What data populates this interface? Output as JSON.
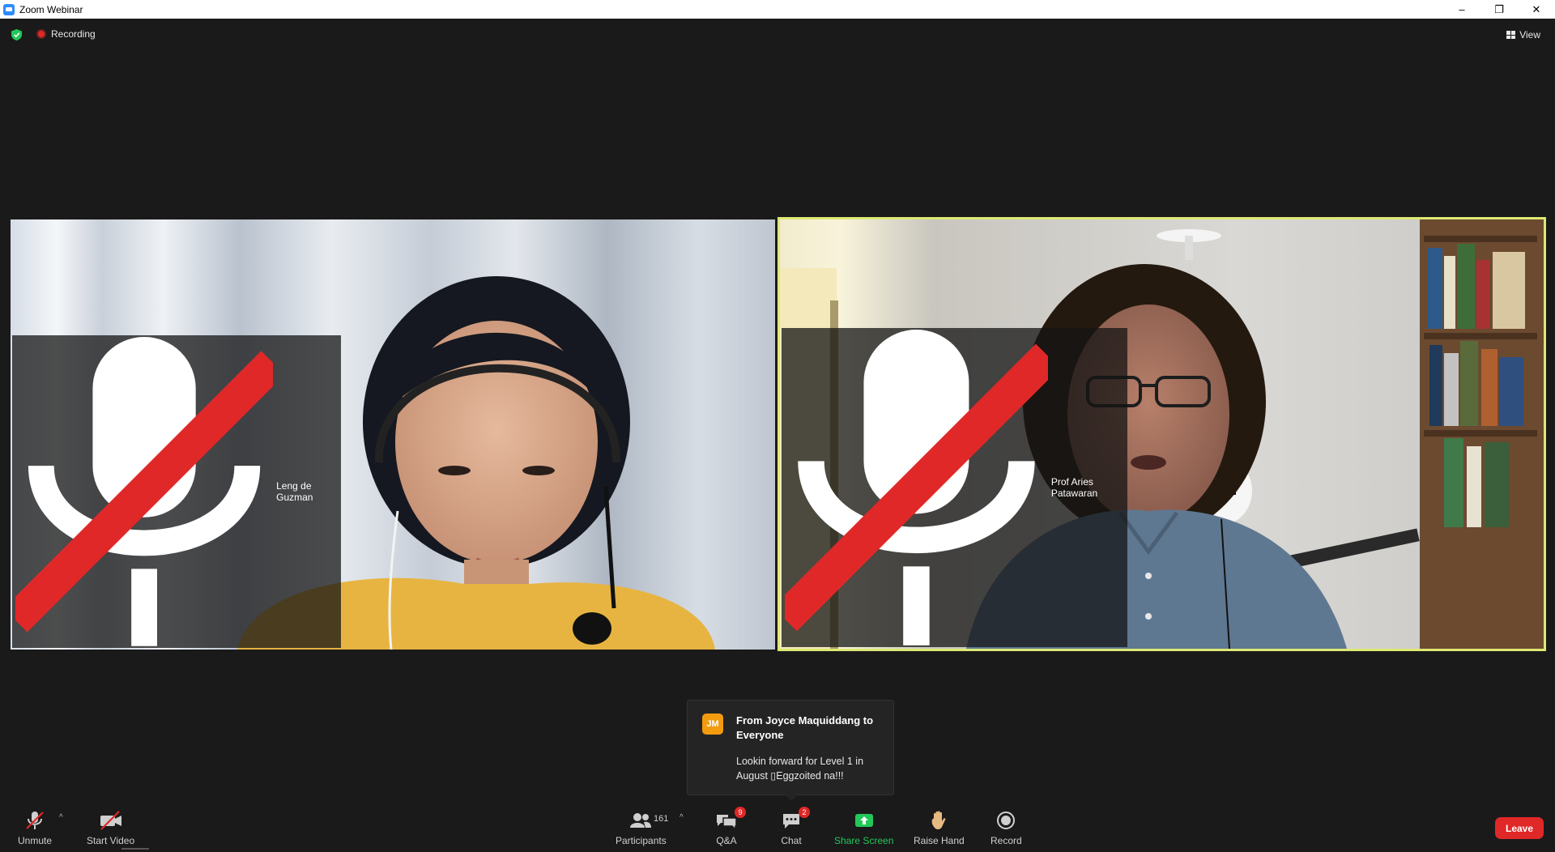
{
  "window": {
    "title": "Zoom Webinar",
    "controls": [
      "–",
      "❐",
      "✕"
    ]
  },
  "status": {
    "recording_label": "Recording",
    "view_label": "View"
  },
  "colors": {
    "active_speaker_border": "#dde874",
    "leave": "#e02828",
    "share_green": "#22c85a",
    "avatar_orange": "#f29b0e"
  },
  "participants": [
    {
      "name": "Leng de Guzman",
      "muted": true
    },
    {
      "name": "Prof Aries Patawaran",
      "muted": true,
      "active_speaker": true
    }
  ],
  "chat_notification": {
    "avatar_initials": "JM",
    "from": "From Joyce Maquiddang to Everyone",
    "message": "Lookin forward for Level 1 in August ▯Eggzoited na!!!"
  },
  "toolbar": {
    "unmute": "Unmute",
    "start_video": "Start Video",
    "participants": "Participants",
    "participants_count": "161",
    "qa": "Q&A",
    "qa_badge": "9",
    "chat": "Chat",
    "chat_badge": "2",
    "share_screen": "Share Screen",
    "raise_hand": "Raise Hand",
    "record": "Record",
    "leave": "Leave"
  }
}
